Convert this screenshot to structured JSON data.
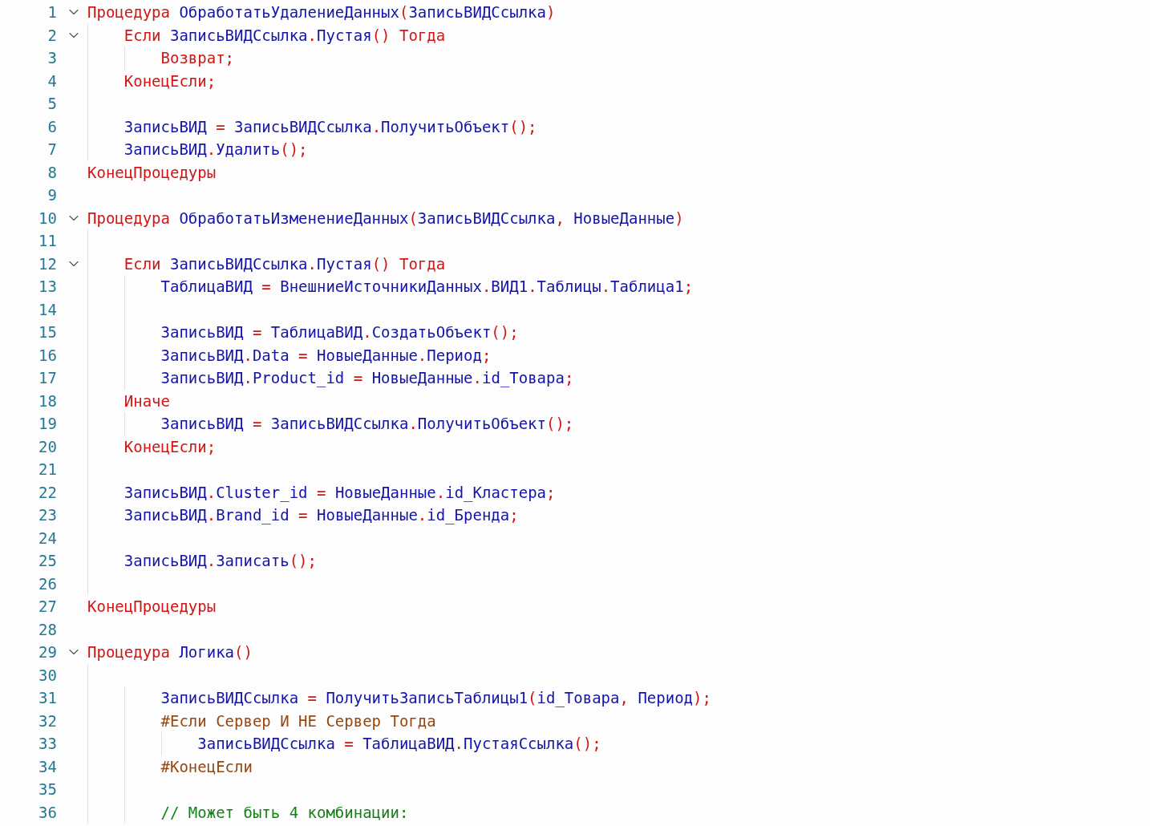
{
  "editor": {
    "lines": [
      {
        "number": "1",
        "expanded": true,
        "tokens": [
          {
            "kind": "keyword",
            "text": "Процедура "
          },
          {
            "kind": "ident",
            "text": "ОбработатьУдалениеДанных"
          },
          {
            "kind": "punct",
            "text": "("
          },
          {
            "kind": "ident",
            "text": "ЗаписьВИДСсылка"
          },
          {
            "kind": "punct",
            "text": ")"
          }
        ]
      },
      {
        "number": "2",
        "expanded": true,
        "indent": [
          {
            "guide": true
          }
        ],
        "tokens": [
          {
            "kind": "keyword",
            "text": "Если "
          },
          {
            "kind": "ident",
            "text": "ЗаписьВИДСсылка"
          },
          {
            "kind": "punct",
            "text": "."
          },
          {
            "kind": "ident",
            "text": "Пустая"
          },
          {
            "kind": "punct",
            "text": "()"
          },
          {
            "kind": "keyword",
            "text": " Тогда"
          }
        ]
      },
      {
        "number": "3",
        "indent": [
          {
            "guide": true
          },
          {
            "guide": true
          }
        ],
        "tokens": [
          {
            "kind": "keyword",
            "text": "Возврат"
          },
          {
            "kind": "punct",
            "text": ";"
          }
        ]
      },
      {
        "number": "4",
        "indent": [
          {
            "guide": true
          }
        ],
        "tokens": [
          {
            "kind": "keyword",
            "text": "КонецЕсли"
          },
          {
            "kind": "punct",
            "text": ";"
          }
        ]
      },
      {
        "number": "5",
        "indent": [
          {
            "guide": true
          }
        ]
      },
      {
        "number": "6",
        "indent": [
          {
            "guide": true
          }
        ],
        "tokens": [
          {
            "kind": "ident",
            "text": "ЗаписьВИД "
          },
          {
            "kind": "punct",
            "text": "="
          },
          {
            "kind": "ident",
            "text": " ЗаписьВИДСсылка"
          },
          {
            "kind": "punct",
            "text": "."
          },
          {
            "kind": "ident",
            "text": "ПолучитьОбъект"
          },
          {
            "kind": "punct",
            "text": "();"
          }
        ]
      },
      {
        "number": "7",
        "indent": [
          {
            "guide": true
          }
        ],
        "tokens": [
          {
            "kind": "ident",
            "text": "ЗаписьВИД"
          },
          {
            "kind": "punct",
            "text": "."
          },
          {
            "kind": "ident",
            "text": "Удалить"
          },
          {
            "kind": "punct",
            "text": "();"
          }
        ]
      },
      {
        "number": "8",
        "tokens": [
          {
            "kind": "keyword",
            "text": "КонецПроцедуры"
          }
        ]
      },
      {
        "number": "9"
      },
      {
        "number": "10",
        "expanded": true,
        "tokens": [
          {
            "kind": "keyword",
            "text": "Процедура "
          },
          {
            "kind": "ident",
            "text": "ОбработатьИзменениеДанных"
          },
          {
            "kind": "punct",
            "text": "("
          },
          {
            "kind": "ident",
            "text": "ЗаписьВИДСсылка"
          },
          {
            "kind": "punct",
            "text": ","
          },
          {
            "kind": "ident",
            "text": " НовыеДанные"
          },
          {
            "kind": "punct",
            "text": ")"
          }
        ]
      },
      {
        "number": "11",
        "indent": [
          {
            "guide": true
          }
        ]
      },
      {
        "number": "12",
        "expanded": true,
        "indent": [
          {
            "guide": true
          }
        ],
        "tokens": [
          {
            "kind": "keyword",
            "text": "Если "
          },
          {
            "kind": "ident",
            "text": "ЗаписьВИДСсылка"
          },
          {
            "kind": "punct",
            "text": "."
          },
          {
            "kind": "ident",
            "text": "Пустая"
          },
          {
            "kind": "punct",
            "text": "()"
          },
          {
            "kind": "keyword",
            "text": " Тогда"
          }
        ]
      },
      {
        "number": "13",
        "indent": [
          {
            "guide": true
          },
          {
            "guide": true
          }
        ],
        "tokens": [
          {
            "kind": "ident",
            "text": "ТаблицаВИД "
          },
          {
            "kind": "punct",
            "text": "="
          },
          {
            "kind": "ident",
            "text": " ВнешниеИсточникиДанных"
          },
          {
            "kind": "punct",
            "text": "."
          },
          {
            "kind": "ident",
            "text": "ВИД1"
          },
          {
            "kind": "punct",
            "text": "."
          },
          {
            "kind": "ident",
            "text": "Таблицы"
          },
          {
            "kind": "punct",
            "text": "."
          },
          {
            "kind": "ident",
            "text": "Таблица1"
          },
          {
            "kind": "punct",
            "text": ";"
          }
        ]
      },
      {
        "number": "14",
        "indent": [
          {
            "guide": true
          },
          {
            "guide": true
          }
        ]
      },
      {
        "number": "15",
        "indent": [
          {
            "guide": true
          },
          {
            "guide": true
          }
        ],
        "tokens": [
          {
            "kind": "ident",
            "text": "ЗаписьВИД "
          },
          {
            "kind": "punct",
            "text": "="
          },
          {
            "kind": "ident",
            "text": " ТаблицаВИД"
          },
          {
            "kind": "punct",
            "text": "."
          },
          {
            "kind": "ident",
            "text": "СоздатьОбъект"
          },
          {
            "kind": "punct",
            "text": "();"
          }
        ]
      },
      {
        "number": "16",
        "indent": [
          {
            "guide": true
          },
          {
            "guide": true
          }
        ],
        "tokens": [
          {
            "kind": "ident",
            "text": "ЗаписьВИД"
          },
          {
            "kind": "punct",
            "text": "."
          },
          {
            "kind": "ident",
            "text": "Data "
          },
          {
            "kind": "punct",
            "text": "="
          },
          {
            "kind": "ident",
            "text": " НовыеДанные"
          },
          {
            "kind": "punct",
            "text": "."
          },
          {
            "kind": "ident",
            "text": "Период"
          },
          {
            "kind": "punct",
            "text": ";"
          }
        ]
      },
      {
        "number": "17",
        "indent": [
          {
            "guide": true
          },
          {
            "guide": true
          }
        ],
        "tokens": [
          {
            "kind": "ident",
            "text": "ЗаписьВИД"
          },
          {
            "kind": "punct",
            "text": "."
          },
          {
            "kind": "ident",
            "text": "Product_id "
          },
          {
            "kind": "punct",
            "text": "="
          },
          {
            "kind": "ident",
            "text": " НовыеДанные"
          },
          {
            "kind": "punct",
            "text": "."
          },
          {
            "kind": "ident",
            "text": "id_Товара"
          },
          {
            "kind": "punct",
            "text": ";"
          }
        ]
      },
      {
        "number": "18",
        "indent": [
          {
            "guide": true
          }
        ],
        "tokens": [
          {
            "kind": "keyword",
            "text": "Иначе"
          }
        ]
      },
      {
        "number": "19",
        "indent": [
          {
            "guide": true
          },
          {
            "guide": true
          }
        ],
        "tokens": [
          {
            "kind": "ident",
            "text": "ЗаписьВИД "
          },
          {
            "kind": "punct",
            "text": "="
          },
          {
            "kind": "ident",
            "text": " ЗаписьВИДСсылка"
          },
          {
            "kind": "punct",
            "text": "."
          },
          {
            "kind": "ident",
            "text": "ПолучитьОбъект"
          },
          {
            "kind": "punct",
            "text": "();"
          }
        ]
      },
      {
        "number": "20",
        "indent": [
          {
            "guide": true
          }
        ],
        "tokens": [
          {
            "kind": "keyword",
            "text": "КонецЕсли"
          },
          {
            "kind": "punct",
            "text": ";"
          }
        ]
      },
      {
        "number": "21",
        "indent": [
          {
            "guide": true
          }
        ]
      },
      {
        "number": "22",
        "indent": [
          {
            "guide": true
          }
        ],
        "tokens": [
          {
            "kind": "ident",
            "text": "ЗаписьВИД"
          },
          {
            "kind": "punct",
            "text": "."
          },
          {
            "kind": "ident",
            "text": "Cluster_id "
          },
          {
            "kind": "punct",
            "text": "="
          },
          {
            "kind": "ident",
            "text": " НовыеДанные"
          },
          {
            "kind": "punct",
            "text": "."
          },
          {
            "kind": "ident",
            "text": "id_Кластера"
          },
          {
            "kind": "punct",
            "text": ";"
          }
        ]
      },
      {
        "number": "23",
        "indent": [
          {
            "guide": true
          }
        ],
        "tokens": [
          {
            "kind": "ident",
            "text": "ЗаписьВИД"
          },
          {
            "kind": "punct",
            "text": "."
          },
          {
            "kind": "ident",
            "text": "Brand_id "
          },
          {
            "kind": "punct",
            "text": "="
          },
          {
            "kind": "ident",
            "text": " НовыеДанные"
          },
          {
            "kind": "punct",
            "text": "."
          },
          {
            "kind": "ident",
            "text": "id_Бренда"
          },
          {
            "kind": "punct",
            "text": ";"
          }
        ]
      },
      {
        "number": "24",
        "indent": [
          {
            "guide": true
          }
        ]
      },
      {
        "number": "25",
        "indent": [
          {
            "guide": true
          }
        ],
        "tokens": [
          {
            "kind": "ident",
            "text": "ЗаписьВИД"
          },
          {
            "kind": "punct",
            "text": "."
          },
          {
            "kind": "ident",
            "text": "Записать"
          },
          {
            "kind": "punct",
            "text": "();"
          }
        ]
      },
      {
        "number": "26",
        "indent": [
          {
            "guide": true
          }
        ]
      },
      {
        "number": "27",
        "tokens": [
          {
            "kind": "keyword",
            "text": "КонецПроцедуры"
          }
        ]
      },
      {
        "number": "28"
      },
      {
        "number": "29",
        "expanded": true,
        "tokens": [
          {
            "kind": "keyword",
            "text": "Процедура "
          },
          {
            "kind": "ident",
            "text": "Логика"
          },
          {
            "kind": "punct",
            "text": "()"
          }
        ]
      },
      {
        "number": "30",
        "indent": [
          {
            "guide": true
          }
        ]
      },
      {
        "number": "31",
        "indent": [
          {
            "guide": true
          },
          {
            "guide": true
          }
        ],
        "tokens": [
          {
            "kind": "ident",
            "text": "ЗаписьВИДСсылка "
          },
          {
            "kind": "punct",
            "text": "="
          },
          {
            "kind": "ident",
            "text": " ПолучитьЗаписьТаблицы1"
          },
          {
            "kind": "punct",
            "text": "("
          },
          {
            "kind": "ident",
            "text": "id_Товара"
          },
          {
            "kind": "punct",
            "text": ","
          },
          {
            "kind": "ident",
            "text": " Период"
          },
          {
            "kind": "punct",
            "text": ");"
          }
        ]
      },
      {
        "number": "32",
        "indent": [
          {
            "guide": true
          },
          {
            "guide": true
          }
        ],
        "tokens": [
          {
            "kind": "directive",
            "text": "#Если Сервер И НЕ Сервер Тогда"
          }
        ]
      },
      {
        "number": "33",
        "indent": [
          {
            "guide": true
          },
          {
            "guide": true
          },
          {
            "guide": true
          }
        ],
        "tokens": [
          {
            "kind": "ident",
            "text": "ЗаписьВИДСсылка "
          },
          {
            "kind": "punct",
            "text": "="
          },
          {
            "kind": "ident",
            "text": " ТаблицаВИД"
          },
          {
            "kind": "punct",
            "text": "."
          },
          {
            "kind": "ident",
            "text": "ПустаяСсылка"
          },
          {
            "kind": "punct",
            "text": "();"
          }
        ]
      },
      {
        "number": "34",
        "indent": [
          {
            "guide": true
          },
          {
            "guide": true
          }
        ],
        "tokens": [
          {
            "kind": "directive",
            "text": "#КонецЕсли"
          }
        ]
      },
      {
        "number": "35",
        "indent": [
          {
            "guide": true
          },
          {
            "guide": true
          }
        ]
      },
      {
        "number": "36",
        "indent": [
          {
            "guide": true
          },
          {
            "guide": true
          }
        ],
        "tokens": [
          {
            "kind": "comment",
            "text": "// Может быть 4 комбинации:"
          }
        ]
      }
    ]
  }
}
